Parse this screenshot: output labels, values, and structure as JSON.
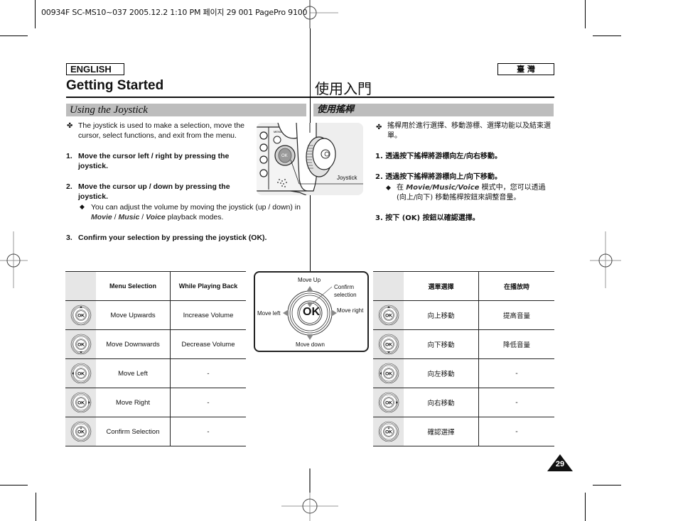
{
  "print_header": "00934F SC-MS10~037  2005.12.2 1:10 PM 페이지 29   001 PagePro 9100",
  "language_en": "ENGLISH",
  "language_zh": "臺 灣",
  "title_en": "Getting Started",
  "title_zh": "使用入門",
  "section_en": "Using the Joystick",
  "section_zh": "使用搖桿",
  "english": {
    "intro_bullet": "✤",
    "intro": "The joystick is used to make a selection, move the cursor, select functions, and exit from the menu.",
    "steps": [
      {
        "num": "1.",
        "text": "Move the cursor left / right by pressing the joystick."
      },
      {
        "num": "2.",
        "text": "Move the cursor up / down by pressing the joystick."
      },
      {
        "num": "3.",
        "text": "Confirm your selection by pressing the joystick (OK)."
      }
    ],
    "note_bullet": "◆",
    "note_pre": "You can adjust the volume by moving the joystick (up / down) in ",
    "note_modes": [
      "Movie",
      "Music",
      "Voice"
    ],
    "note_sep": " / ",
    "note_post": " playback modes."
  },
  "chinese": {
    "intro_bullet": "✤",
    "intro": "搖桿用於進行選擇、移動游標、選擇功能以及結束選單。",
    "steps": [
      {
        "num": "1.",
        "text": "透過按下搖桿將游標向左/向右移動。"
      },
      {
        "num": "2.",
        "text": "透過按下搖桿將游標向上/向下移動。"
      },
      {
        "num": "3.",
        "text": "按下 (OK) 按鈕以確認選擇。"
      }
    ],
    "note_bullet": "◆",
    "note_pre": "在 ",
    "note_modes": "Movie/Music/Voice",
    "note_post": " 模式中，您可以透過 (向上/向下) 移動搖桿按鈕來調整音量。"
  },
  "photo": {
    "label": "Joystick",
    "ok_label": "OK",
    "menu_label": "MENU"
  },
  "table_en": {
    "headers": [
      "",
      "Menu Selection",
      "While Playing Back"
    ],
    "rows": [
      {
        "icon": "joystick-up-icon",
        "menu": "Move Upwards",
        "playback": "Increase Volume"
      },
      {
        "icon": "joystick-down-icon",
        "menu": "Move Downwards",
        "playback": "Decrease Volume"
      },
      {
        "icon": "joystick-left-icon",
        "menu": "Move Left",
        "playback": "-"
      },
      {
        "icon": "joystick-right-icon",
        "menu": "Move Right",
        "playback": "-"
      },
      {
        "icon": "joystick-press-icon",
        "menu": "Confirm Selection",
        "playback": "-"
      }
    ]
  },
  "table_zh": {
    "headers": [
      "",
      "選單選擇",
      "在播放時"
    ],
    "rows": [
      {
        "icon": "joystick-up-icon",
        "menu": "向上移動",
        "playback": "提高音量"
      },
      {
        "icon": "joystick-down-icon",
        "menu": "向下移動",
        "playback": "降低音量"
      },
      {
        "icon": "joystick-left-icon",
        "menu": "向左移動",
        "playback": "-"
      },
      {
        "icon": "joystick-right-icon",
        "menu": "向右移動",
        "playback": "-"
      },
      {
        "icon": "joystick-press-icon",
        "menu": "確認選擇",
        "playback": "-"
      }
    ]
  },
  "diagram": {
    "center": "OK",
    "up": "Move Up",
    "down": "Move down",
    "left": "Move left",
    "right": "Move right",
    "confirm_line1": "Confirm",
    "confirm_line2": "selection"
  },
  "page_number": "29",
  "colors": {
    "section_bar": "#bdbdbd",
    "icon_cell": "#e6e6e6",
    "arrow": "#888888"
  }
}
